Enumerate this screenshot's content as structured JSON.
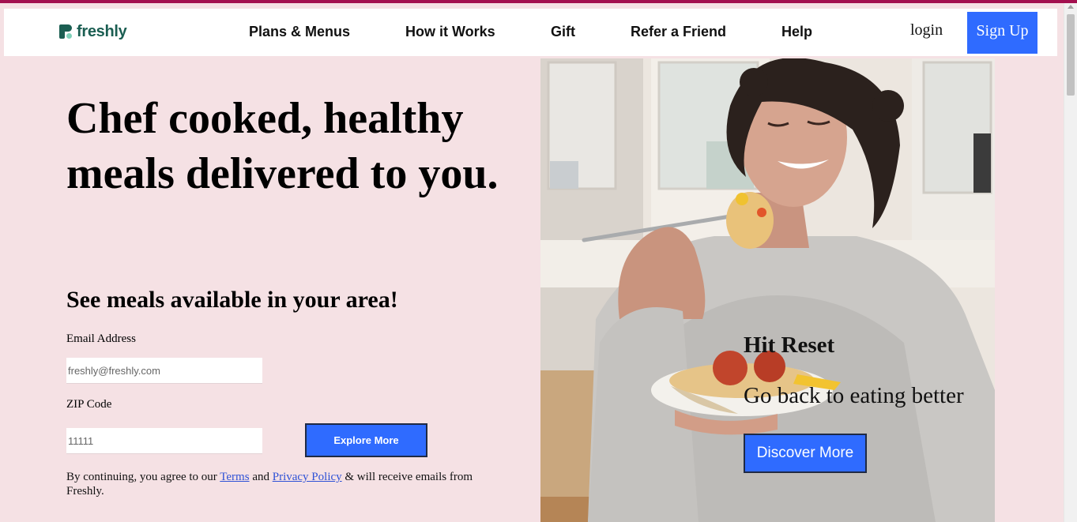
{
  "header": {
    "logo_text": "freshly",
    "nav": [
      {
        "label": "Plans & Menus"
      },
      {
        "label": "How it Works"
      },
      {
        "label": "Gift"
      },
      {
        "label": "Refer a Friend"
      },
      {
        "label": "Help"
      }
    ],
    "login_label": "login",
    "signup_label": "Sign Up"
  },
  "hero": {
    "title": "Chef cooked, healthy meals delivered to you.",
    "subheading": "See meals available in your area!",
    "email_label": "Email Address",
    "email_placeholder": "freshly@freshly.com",
    "zip_label": "ZIP Code",
    "zip_placeholder": "11111",
    "explore_label": "Explore More",
    "legal_prefix": "By continuing, you agree to our ",
    "terms_label": "Terms",
    "legal_and": " and ",
    "privacy_label": "Privacy Policy",
    "legal_suffix": " & will receive emails from Freshly."
  },
  "promo": {
    "title": "Hit Reset",
    "subtitle": "Go back to eating better",
    "button_label": "Discover More",
    "image_subject": "woman eating pasta with meatballs"
  },
  "colors": {
    "page_bg": "#f5e1e4",
    "accent_blue": "#2f6bff",
    "brand_green": "#1b5e52",
    "top_strip": "#a3104f"
  }
}
